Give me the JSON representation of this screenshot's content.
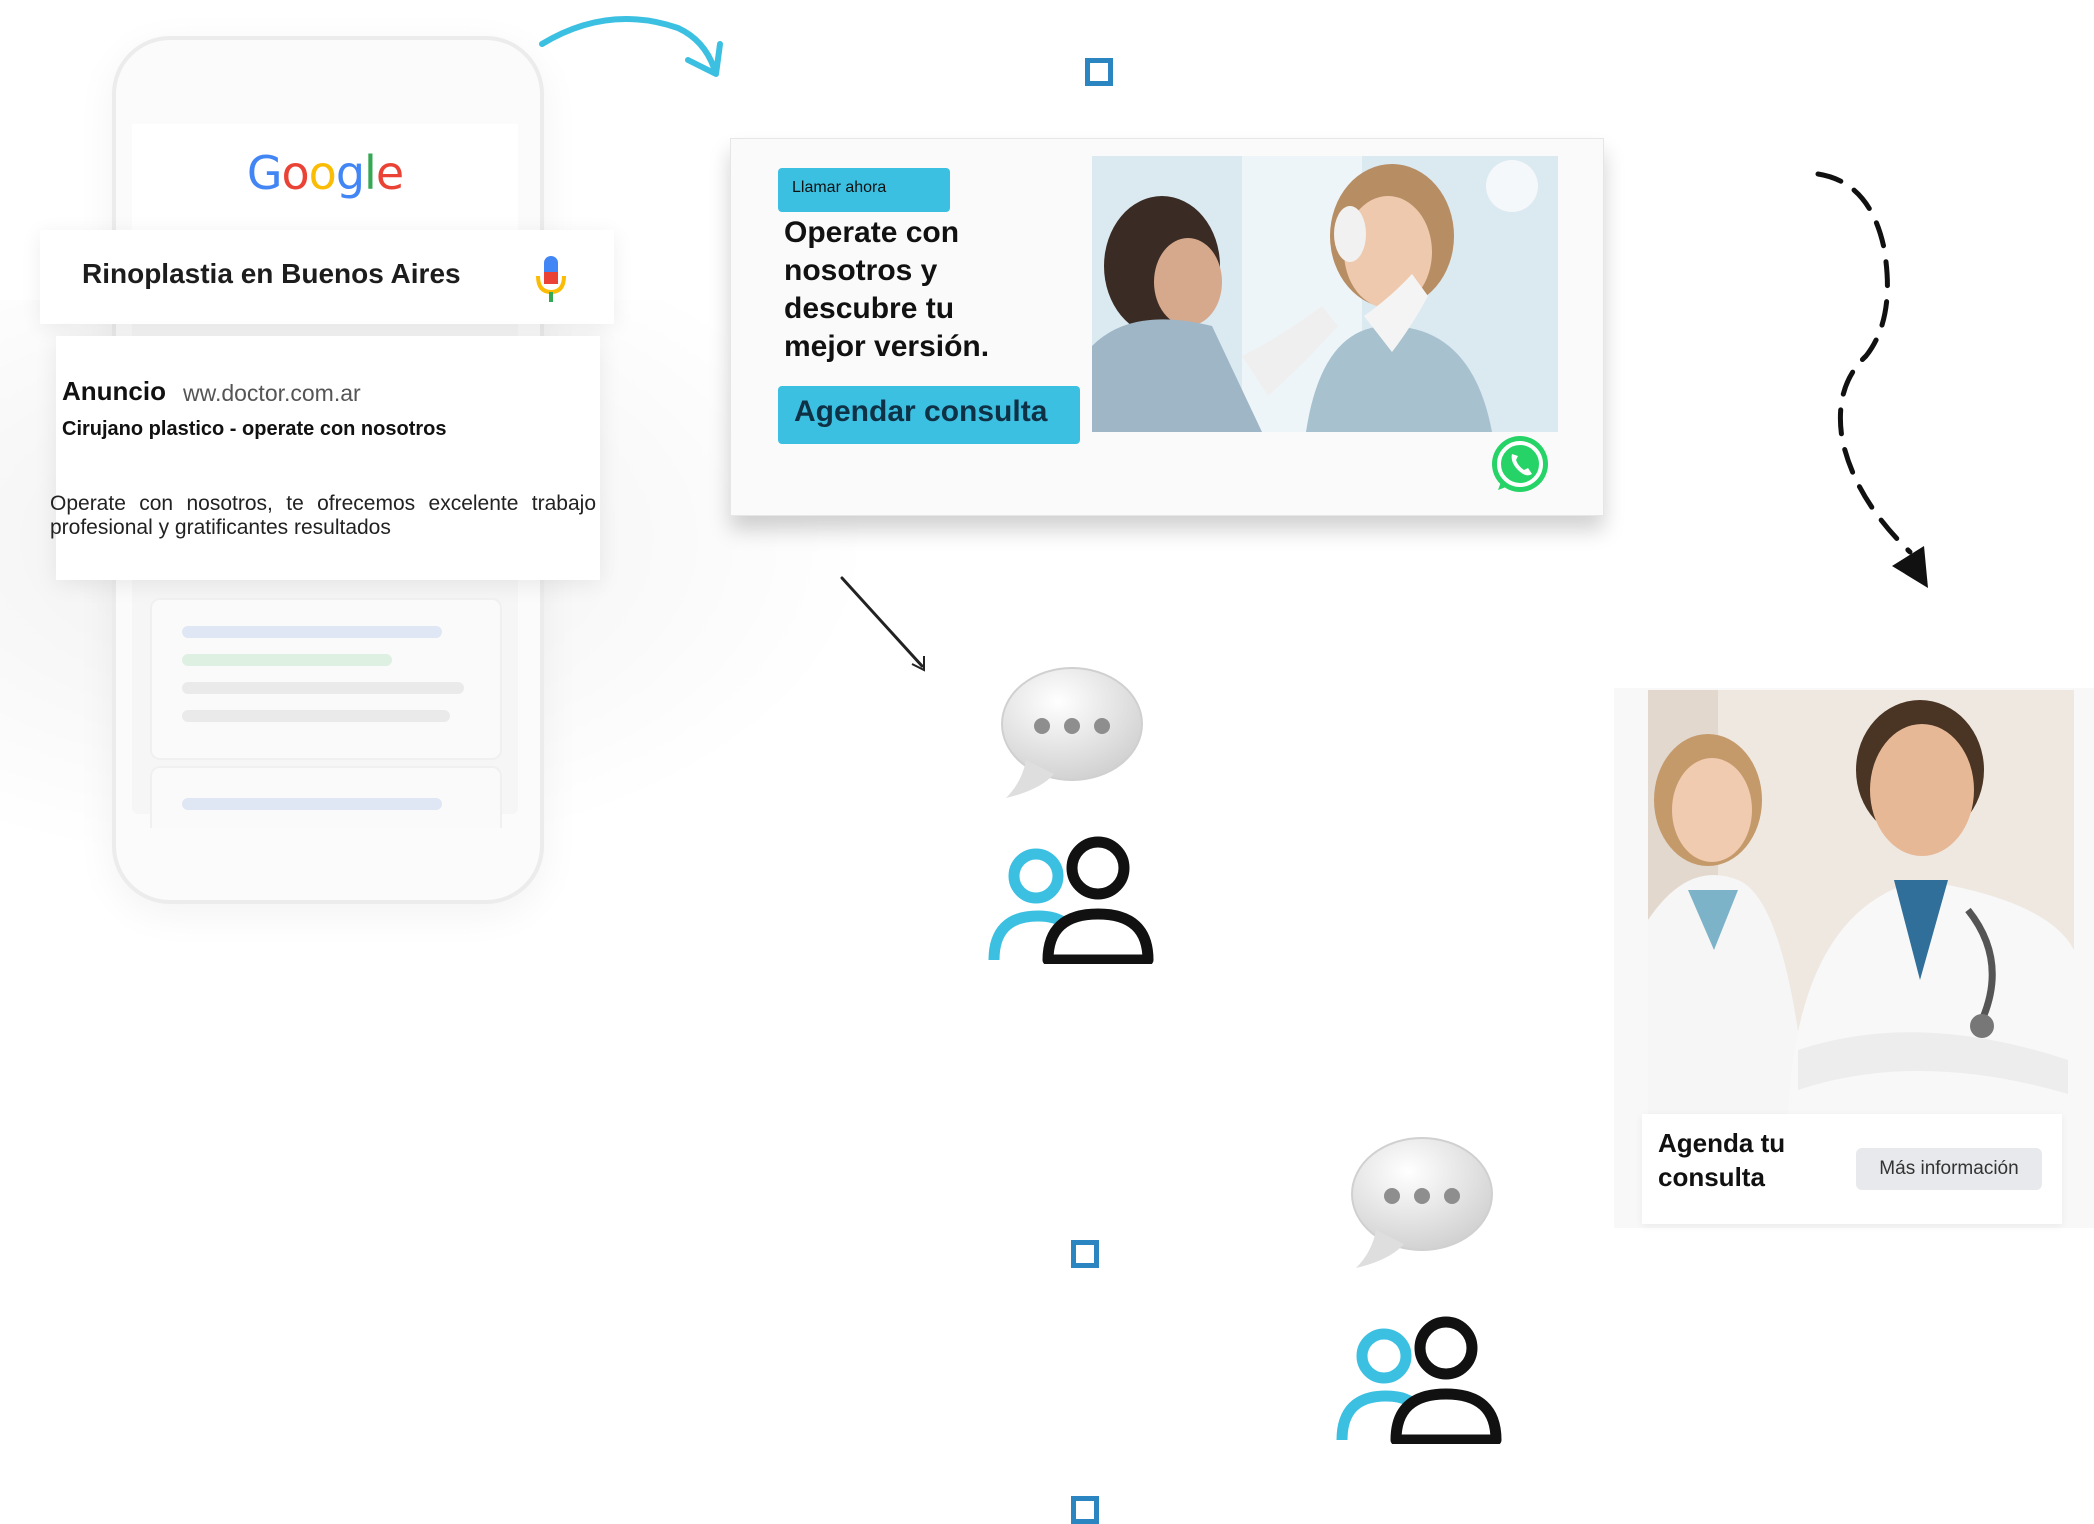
{
  "phone": {
    "brand": "Google",
    "search_query": "Rinoplastia en Buenos Aires",
    "ad": {
      "label": "Anuncio",
      "url": "ww.doctor.com.ar",
      "headline": "Cirujano plastico - operate con nosotros",
      "description": "Operate con nosotros, te ofrecemos excelente trabajo profesional y gratificantes resultados"
    }
  },
  "banner": {
    "call_label": "Llamar ahora",
    "title": "Operate con nosotros y descubre tu mejor versión.",
    "book_label": "Agendar consulta"
  },
  "doctors_card": {
    "title": "Agenda tu consulta",
    "more_label": "Más información"
  },
  "colors": {
    "accent": "#3cc0e2",
    "square": "#2a85c0",
    "whatsapp": "#25d366"
  },
  "icons": [
    "arrow-curved-icon",
    "arrow-straight-icon",
    "arrow-dashed-icon",
    "speech-bubble-icon",
    "users-icon",
    "whatsapp-icon",
    "mic-icon"
  ]
}
